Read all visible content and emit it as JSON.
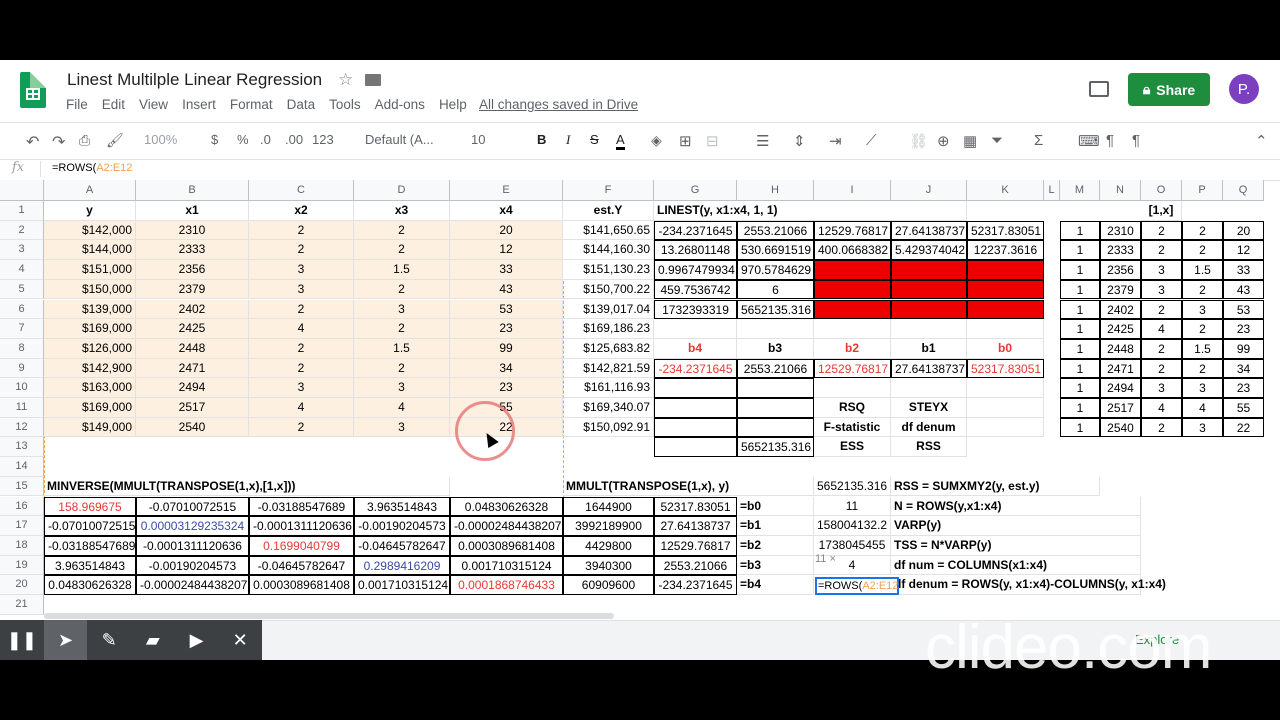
{
  "doc": {
    "title": "Linest Multilple Linear Regression",
    "share_label": "Share",
    "avatar_letter": "P.",
    "saved_text": "All changes saved in Drive"
  },
  "menu": [
    "File",
    "Edit",
    "View",
    "Insert",
    "Format",
    "Data",
    "Tools",
    "Add-ons",
    "Help"
  ],
  "toolbar": {
    "zoom": "100%",
    "currency": "$",
    "percent": "%",
    "dec_less": ".0",
    "dec_more": ".00",
    "format_more": "123",
    "font": "Default (A...",
    "font_size": "10",
    "bold": "B",
    "italic": "I",
    "strike": "S",
    "text_color": "A"
  },
  "formula_bar": {
    "fx": "fx",
    "prefix": "=ROWS(",
    "ref": "A2:E12"
  },
  "columns": [
    {
      "label": "A",
      "w": 92
    },
    {
      "label": "B",
      "w": 113
    },
    {
      "label": "C",
      "w": 105
    },
    {
      "label": "D",
      "w": 96
    },
    {
      "label": "E",
      "w": 113
    },
    {
      "label": "F",
      "w": 91
    },
    {
      "label": "G",
      "w": 83
    },
    {
      "label": "H",
      "w": 77
    },
    {
      "label": "I",
      "w": 77
    },
    {
      "label": "J",
      "w": 76
    },
    {
      "label": "K",
      "w": 77
    },
    {
      "label": "L",
      "w": 16
    },
    {
      "label": "M",
      "w": 40
    },
    {
      "label": "N",
      "w": 41
    },
    {
      "label": "O",
      "w": 41
    },
    {
      "label": "P",
      "w": 41
    },
    {
      "label": "Q",
      "w": 41
    }
  ],
  "rows": [
    "1",
    "2",
    "3",
    "4",
    "5",
    "6",
    "7",
    "8",
    "9",
    "10",
    "11",
    "12",
    "13",
    "14",
    "15",
    "16",
    "17",
    "18",
    "19",
    "20",
    "21"
  ],
  "sheet": {
    "headers": {
      "A": "y",
      "B": "x1",
      "C": "x2",
      "D": "x3",
      "E": "x4",
      "F": "est.Y",
      "G": "LINEST(y, x1:x4, 1, 1)",
      "O": "[1,x]"
    },
    "data": [
      [
        "$142,000",
        "2310",
        "2",
        "2",
        "20",
        "$141,650.65",
        "-234.2371645",
        "2553.21066",
        "12529.76817",
        "27.64138737",
        "52317.83051",
        "1",
        "2310",
        "2",
        "2",
        "20"
      ],
      [
        "$144,000",
        "2333",
        "2",
        "2",
        "12",
        "$144,160.30",
        "13.26801148",
        "530.6691519",
        "400.0668382",
        "5.429374042",
        "12237.3616",
        "1",
        "2333",
        "2",
        "2",
        "12"
      ],
      [
        "$151,000",
        "2356",
        "3",
        "1.5",
        "33",
        "$151,130.23",
        "0.9967479934",
        "970.5784629",
        "",
        "",
        "",
        "1",
        "2356",
        "3",
        "1.5",
        "33"
      ],
      [
        "$150,000",
        "2379",
        "3",
        "2",
        "43",
        "$150,700.22",
        "459.7536742",
        "6",
        "",
        "",
        "",
        "1",
        "2379",
        "3",
        "2",
        "43"
      ],
      [
        "$139,000",
        "2402",
        "2",
        "3",
        "53",
        "$139,017.04",
        "1732393319",
        "5652135.316",
        "",
        "",
        "",
        "1",
        "2402",
        "2",
        "3",
        "53"
      ],
      [
        "$169,000",
        "2425",
        "4",
        "2",
        "23",
        "$169,186.23",
        "",
        "",
        "",
        "",
        "",
        "1",
        "2425",
        "4",
        "2",
        "23"
      ],
      [
        "$126,000",
        "2448",
        "2",
        "1.5",
        "99",
        "$125,683.82",
        "b4",
        "b3",
        "b2",
        "b1",
        "b0",
        "1",
        "2448",
        "2",
        "1.5",
        "99"
      ],
      [
        "$142,900",
        "2471",
        "2",
        "2",
        "34",
        "$142,821.59",
        "-234.2371645",
        "2553.21066",
        "12529.76817",
        "27.64138737",
        "52317.83051",
        "1",
        "2471",
        "2",
        "2",
        "34"
      ],
      [
        "$163,000",
        "2494",
        "3",
        "3",
        "23",
        "$161,116.93",
        "",
        "",
        "",
        "",
        "",
        "1",
        "2494",
        "3",
        "3",
        "23"
      ],
      [
        "$169,000",
        "2517",
        "4",
        "4",
        "55",
        "$169,340.07",
        "",
        "",
        "RSQ",
        "STEYX",
        "",
        "1",
        "2517",
        "4",
        "4",
        "55"
      ],
      [
        "$149,000",
        "2540",
        "2",
        "3",
        "22",
        "$150,092.91",
        "",
        "",
        "F-statistic",
        "df denum",
        "",
        "1",
        "2540",
        "2",
        "3",
        "22"
      ]
    ],
    "r13": {
      "H": "5652135.316",
      "I": "ESS",
      "J": "RSS"
    },
    "r15": {
      "A": "MINVERSE(MMULT(TRANSPOSE(1,x),[1,x]))",
      "F": "MMULT(TRANSPOSE(1,x), y)",
      "I": "5652135.316",
      "J": "RSS = SUMXMY2(y, est.y)"
    },
    "minv": [
      [
        "158.969675",
        "-0.07010072515",
        "-0.03188547689",
        "3.963514843",
        "0.04830626328"
      ],
      [
        "-0.07010072515",
        "0.00003129235324",
        "-0.0001311120636",
        "-0.00190204573",
        "-0.00002484438207"
      ],
      [
        "-0.03188547689",
        "-0.0001311120636",
        "0.1699040799",
        "-0.04645782647",
        "0.0003089681408"
      ],
      [
        "3.963514843",
        "-0.00190204573",
        "-0.04645782647",
        "0.2989416209",
        "0.001710315124"
      ],
      [
        "0.04830626328",
        "-0.00002484438207",
        "0.0003089681408",
        "0.001710315124",
        "0.0001868746433"
      ]
    ],
    "mmult": [
      "1644900",
      "3992189900",
      "4429800",
      "3940300",
      "60909600"
    ],
    "coef": [
      "52317.83051",
      "27.64138737",
      "12529.76817",
      "2553.21066",
      "-234.2371645"
    ],
    "coef_labels": [
      "=b0",
      "=b1",
      "=b2",
      "=b3",
      "=b4"
    ],
    "right_vals": [
      "11",
      "158004132.2",
      "1738045455",
      "4",
      ""
    ],
    "right_labels": [
      "N = ROWS(y,x1:x4)",
      "VARP(y)",
      "TSS = N*VARP(y)",
      "df num = COLUMNS(x1:x4)",
      "df denum = ROWS(y, x1:x4)-COLUMNS(y, x1:x4)"
    ]
  },
  "edit": {
    "prefix": "=ROWS(",
    "ref": "A2:E12",
    "tooltip": "11 ×"
  },
  "explore_label": "Explore",
  "watermark": "clideo.com",
  "colors": {
    "accent_green": "#1e8e3e",
    "red_fill": "#ee0000",
    "red_text": "#e53935",
    "blue_text": "#3949ab",
    "selection": "#f5a142"
  }
}
